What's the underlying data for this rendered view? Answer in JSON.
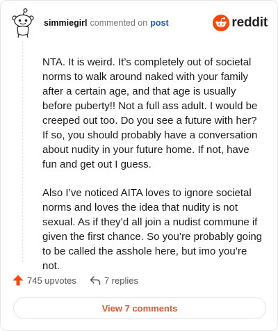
{
  "header": {
    "username": "simmiegirl",
    "action_text": "commented on",
    "post_link": "post",
    "logo_text": "reddit"
  },
  "comment": {
    "paragraphs": [
      "NTA. It is weird. It’s completely out of societal norms to walk around naked with your family after a certain age, and that age is usually before puberty!! Not a full ass adult. I would be creeped out too. Do you see a future with her? If so, you should probably have a conversation about nudity in your future home. If not, have fun and get out I guess.",
      "Also I’ve noticed AITA loves to ignore societal norms and loves the idea that nudity is not sexual. As if they’d all join a nudist commune if given the first chance. So you’re probably going to be called the asshole here, but imo you’re not."
    ]
  },
  "actions": {
    "upvotes_label": "745 upvotes",
    "replies_label": "7 replies",
    "view_comments_label": "View 7 comments"
  },
  "icons": {
    "avatar": "snoo-avatar-icon",
    "logo": "reddit-logo-icon",
    "upvote": "upvote-arrow-icon",
    "reply": "reply-arrow-icon"
  },
  "colors": {
    "brand": "#ff4500",
    "link": "#1a5dbf",
    "view_comments": "#e8572c"
  }
}
